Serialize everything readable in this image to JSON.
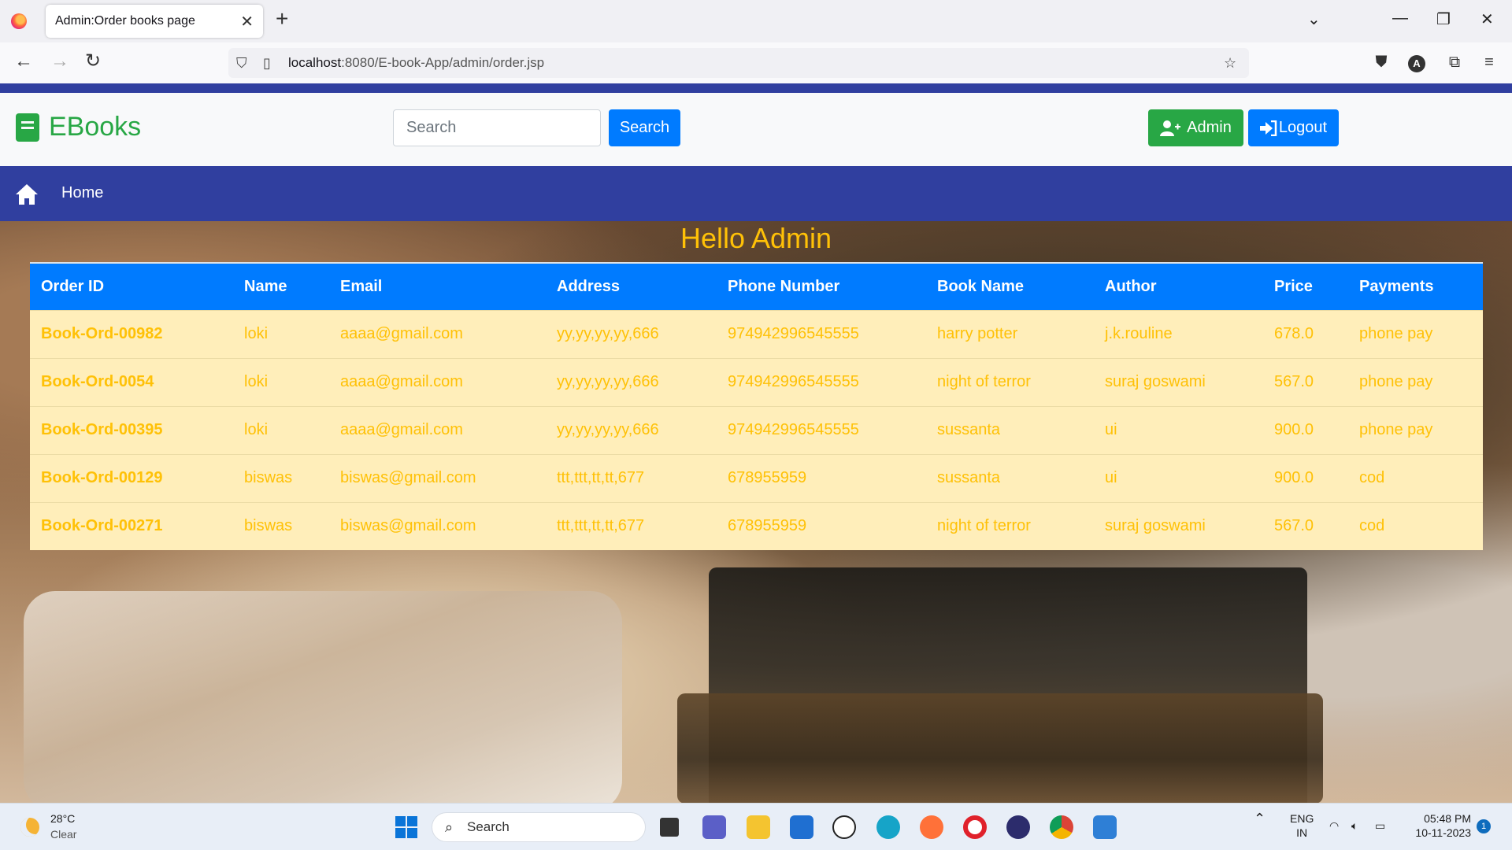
{
  "browser": {
    "tab_title": "Admin:Order books page",
    "url_host": "localhost",
    "url_rest": ":8080/E-book-App/admin/order.jsp"
  },
  "header": {
    "brand": "EBooks",
    "search_placeholder": "Search",
    "search_button": "Search",
    "admin_button": "Admin",
    "logout_button": "Logout"
  },
  "nav": {
    "home": "Home"
  },
  "greeting": "Hello Admin",
  "table": {
    "columns": [
      "Order ID",
      "Name",
      "Email",
      "Address",
      "Phone Number",
      "Book Name",
      "Author",
      "Price",
      "Payments"
    ],
    "rows": [
      [
        "Book-Ord-00982",
        "loki",
        "aaaa@gmail.com",
        "yy,yy,yy,yy,666",
        "974942996545555",
        "harry potter",
        "j.k.rouline",
        "678.0",
        "phone pay"
      ],
      [
        "Book-Ord-0054",
        "loki",
        "aaaa@gmail.com",
        "yy,yy,yy,yy,666",
        "974942996545555",
        "night of terror",
        "suraj goswami",
        "567.0",
        "phone pay"
      ],
      [
        "Book-Ord-00395",
        "loki",
        "aaaa@gmail.com",
        "yy,yy,yy,yy,666",
        "974942996545555",
        "sussanta",
        "ui",
        "900.0",
        "phone pay"
      ],
      [
        "Book-Ord-00129",
        "biswas",
        "biswas@gmail.com",
        "ttt,ttt,tt,tt,677",
        "678955959",
        "sussanta",
        "ui",
        "900.0",
        "cod"
      ],
      [
        "Book-Ord-00271",
        "biswas",
        "biswas@gmail.com",
        "ttt,ttt,tt,tt,677",
        "678955959",
        "night of terror",
        "suraj goswami",
        "567.0",
        "cod"
      ]
    ]
  },
  "taskbar": {
    "temperature": "28°C",
    "weather": "Clear",
    "search": "Search",
    "lang_1": "ENG",
    "lang_2": "IN",
    "time": "05:48 PM",
    "date": "10-11-2023",
    "notification_count": "1"
  },
  "colors": {
    "nav_blue": "#303f9f",
    "primary": "#007bff",
    "success": "#28a745",
    "warning": "#ffc107",
    "row_bg": "#ffeeba"
  }
}
